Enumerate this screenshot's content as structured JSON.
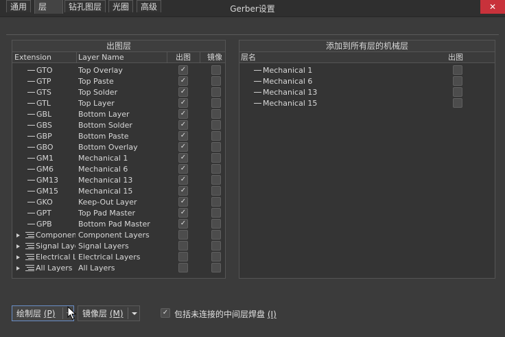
{
  "window": {
    "title": "Gerber设置",
    "close": "✕"
  },
  "tabs": [
    "通用",
    "层",
    "钻孔图层",
    "光圈",
    "高级"
  ],
  "left_panel": {
    "title": "出图层",
    "columns": {
      "extension": "Extension",
      "layer_name": "Layer Name",
      "plot": "出图",
      "mirror": "镜像"
    },
    "rows": [
      {
        "ext": "GTO",
        "name": "Top Overlay",
        "plot": true,
        "mirror": false,
        "kind": "single"
      },
      {
        "ext": "GTP",
        "name": "Top Paste",
        "plot": true,
        "mirror": false,
        "kind": "single"
      },
      {
        "ext": "GTS",
        "name": "Top Solder",
        "plot": true,
        "mirror": false,
        "kind": "single"
      },
      {
        "ext": "GTL",
        "name": "Top Layer",
        "plot": true,
        "mirror": false,
        "kind": "single"
      },
      {
        "ext": "GBL",
        "name": "Bottom Layer",
        "plot": true,
        "mirror": false,
        "kind": "single"
      },
      {
        "ext": "GBS",
        "name": "Bottom Solder",
        "plot": true,
        "mirror": false,
        "kind": "single"
      },
      {
        "ext": "GBP",
        "name": "Bottom Paste",
        "plot": true,
        "mirror": false,
        "kind": "single"
      },
      {
        "ext": "GBO",
        "name": "Bottom Overlay",
        "plot": true,
        "mirror": false,
        "kind": "single"
      },
      {
        "ext": "GM1",
        "name": "Mechanical 1",
        "plot": true,
        "mirror": false,
        "kind": "single"
      },
      {
        "ext": "GM6",
        "name": "Mechanical 6",
        "plot": true,
        "mirror": false,
        "kind": "single"
      },
      {
        "ext": "GM13",
        "name": "Mechanical 13",
        "plot": true,
        "mirror": false,
        "kind": "single"
      },
      {
        "ext": "GM15",
        "name": "Mechanical 15",
        "plot": true,
        "mirror": false,
        "kind": "single"
      },
      {
        "ext": "GKO",
        "name": "Keep-Out Layer",
        "plot": true,
        "mirror": false,
        "kind": "single"
      },
      {
        "ext": "GPT",
        "name": "Top Pad Master",
        "plot": true,
        "mirror": false,
        "kind": "single"
      },
      {
        "ext": "GPB",
        "name": "Bottom Pad Master",
        "plot": true,
        "mirror": false,
        "kind": "single"
      },
      {
        "ext": "Component",
        "name": "Component Layers",
        "plot": false,
        "mirror": false,
        "kind": "group"
      },
      {
        "ext": "Signal Layer",
        "name": "Signal Layers",
        "plot": false,
        "mirror": false,
        "kind": "group"
      },
      {
        "ext": "Electrical La",
        "name": "Electrical Layers",
        "plot": false,
        "mirror": false,
        "kind": "group"
      },
      {
        "ext": "All Layers",
        "name": "All Layers",
        "plot": false,
        "mirror": false,
        "kind": "group"
      }
    ]
  },
  "right_panel": {
    "title": "添加到所有层的机械层",
    "columns": {
      "layer_name": "层名",
      "plot": "出图"
    },
    "rows": [
      {
        "name": "Mechanical 1",
        "plot": false
      },
      {
        "name": "Mechanical 6",
        "plot": false
      },
      {
        "name": "Mechanical 13",
        "plot": false
      },
      {
        "name": "Mechanical 15",
        "plot": false
      }
    ]
  },
  "bottom": {
    "plot_layers_button": {
      "label": "绘制层",
      "hotkey": "(P)"
    },
    "mirror_layers_button": {
      "label": "镜像层",
      "hotkey": "(M)"
    },
    "include_unconnected_pads": {
      "label": "包括未连接的中间层焊盘",
      "hotkey": "(I)",
      "checked": true
    }
  },
  "check_glyph": "✓"
}
